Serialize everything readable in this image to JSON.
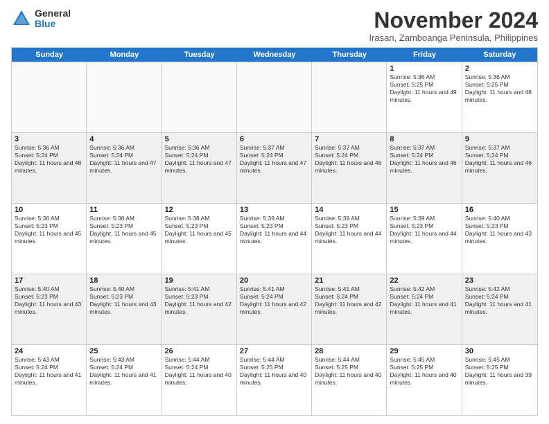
{
  "logo": {
    "general": "General",
    "blue": "Blue"
  },
  "title": "November 2024",
  "location": "Irasan, Zamboanga Peninsula, Philippines",
  "weekdays": [
    "Sunday",
    "Monday",
    "Tuesday",
    "Wednesday",
    "Thursday",
    "Friday",
    "Saturday"
  ],
  "rows": [
    [
      {
        "day": "",
        "empty": true
      },
      {
        "day": "",
        "empty": true
      },
      {
        "day": "",
        "empty": true
      },
      {
        "day": "",
        "empty": true
      },
      {
        "day": "",
        "empty": true
      },
      {
        "day": "1",
        "info": "Sunrise: 5:36 AM\nSunset: 5:25 PM\nDaylight: 11 hours and 49 minutes."
      },
      {
        "day": "2",
        "info": "Sunrise: 5:36 AM\nSunset: 5:25 PM\nDaylight: 11 hours and 48 minutes."
      }
    ],
    [
      {
        "day": "3",
        "info": "Sunrise: 5:36 AM\nSunset: 5:24 PM\nDaylight: 11 hours and 48 minutes."
      },
      {
        "day": "4",
        "info": "Sunrise: 5:36 AM\nSunset: 5:24 PM\nDaylight: 11 hours and 47 minutes."
      },
      {
        "day": "5",
        "info": "Sunrise: 5:36 AM\nSunset: 5:24 PM\nDaylight: 11 hours and 47 minutes."
      },
      {
        "day": "6",
        "info": "Sunrise: 5:37 AM\nSunset: 5:24 PM\nDaylight: 11 hours and 47 minutes."
      },
      {
        "day": "7",
        "info": "Sunrise: 5:37 AM\nSunset: 5:24 PM\nDaylight: 11 hours and 46 minutes."
      },
      {
        "day": "8",
        "info": "Sunrise: 5:37 AM\nSunset: 5:24 PM\nDaylight: 11 hours and 46 minutes."
      },
      {
        "day": "9",
        "info": "Sunrise: 5:37 AM\nSunset: 5:24 PM\nDaylight: 11 hours and 46 minutes."
      }
    ],
    [
      {
        "day": "10",
        "info": "Sunrise: 5:38 AM\nSunset: 5:23 PM\nDaylight: 11 hours and 45 minutes."
      },
      {
        "day": "11",
        "info": "Sunrise: 5:38 AM\nSunset: 5:23 PM\nDaylight: 11 hours and 45 minutes."
      },
      {
        "day": "12",
        "info": "Sunrise: 5:38 AM\nSunset: 5:23 PM\nDaylight: 11 hours and 45 minutes."
      },
      {
        "day": "13",
        "info": "Sunrise: 5:39 AM\nSunset: 5:23 PM\nDaylight: 11 hours and 44 minutes."
      },
      {
        "day": "14",
        "info": "Sunrise: 5:39 AM\nSunset: 5:23 PM\nDaylight: 11 hours and 44 minutes."
      },
      {
        "day": "15",
        "info": "Sunrise: 5:39 AM\nSunset: 5:23 PM\nDaylight: 11 hours and 44 minutes."
      },
      {
        "day": "16",
        "info": "Sunrise: 5:40 AM\nSunset: 5:23 PM\nDaylight: 11 hours and 43 minutes."
      }
    ],
    [
      {
        "day": "17",
        "info": "Sunrise: 5:40 AM\nSunset: 5:23 PM\nDaylight: 11 hours and 43 minutes."
      },
      {
        "day": "18",
        "info": "Sunrise: 5:40 AM\nSunset: 5:23 PM\nDaylight: 11 hours and 43 minutes."
      },
      {
        "day": "19",
        "info": "Sunrise: 5:41 AM\nSunset: 5:23 PM\nDaylight: 11 hours and 42 minutes."
      },
      {
        "day": "20",
        "info": "Sunrise: 5:41 AM\nSunset: 5:24 PM\nDaylight: 11 hours and 42 minutes."
      },
      {
        "day": "21",
        "info": "Sunrise: 5:41 AM\nSunset: 5:24 PM\nDaylight: 11 hours and 42 minutes."
      },
      {
        "day": "22",
        "info": "Sunrise: 5:42 AM\nSunset: 5:24 PM\nDaylight: 11 hours and 41 minutes."
      },
      {
        "day": "23",
        "info": "Sunrise: 5:42 AM\nSunset: 5:24 PM\nDaylight: 11 hours and 41 minutes."
      }
    ],
    [
      {
        "day": "24",
        "info": "Sunrise: 5:43 AM\nSunset: 5:24 PM\nDaylight: 11 hours and 41 minutes."
      },
      {
        "day": "25",
        "info": "Sunrise: 5:43 AM\nSunset: 5:24 PM\nDaylight: 11 hours and 41 minutes."
      },
      {
        "day": "26",
        "info": "Sunrise: 5:44 AM\nSunset: 5:24 PM\nDaylight: 11 hours and 40 minutes."
      },
      {
        "day": "27",
        "info": "Sunrise: 5:44 AM\nSunset: 5:25 PM\nDaylight: 11 hours and 40 minutes."
      },
      {
        "day": "28",
        "info": "Sunrise: 5:44 AM\nSunset: 5:25 PM\nDaylight: 11 hours and 40 minutes."
      },
      {
        "day": "29",
        "info": "Sunrise: 5:45 AM\nSunset: 5:25 PM\nDaylight: 11 hours and 40 minutes."
      },
      {
        "day": "30",
        "info": "Sunrise: 5:45 AM\nSunset: 5:25 PM\nDaylight: 11 hours and 39 minutes."
      }
    ]
  ]
}
